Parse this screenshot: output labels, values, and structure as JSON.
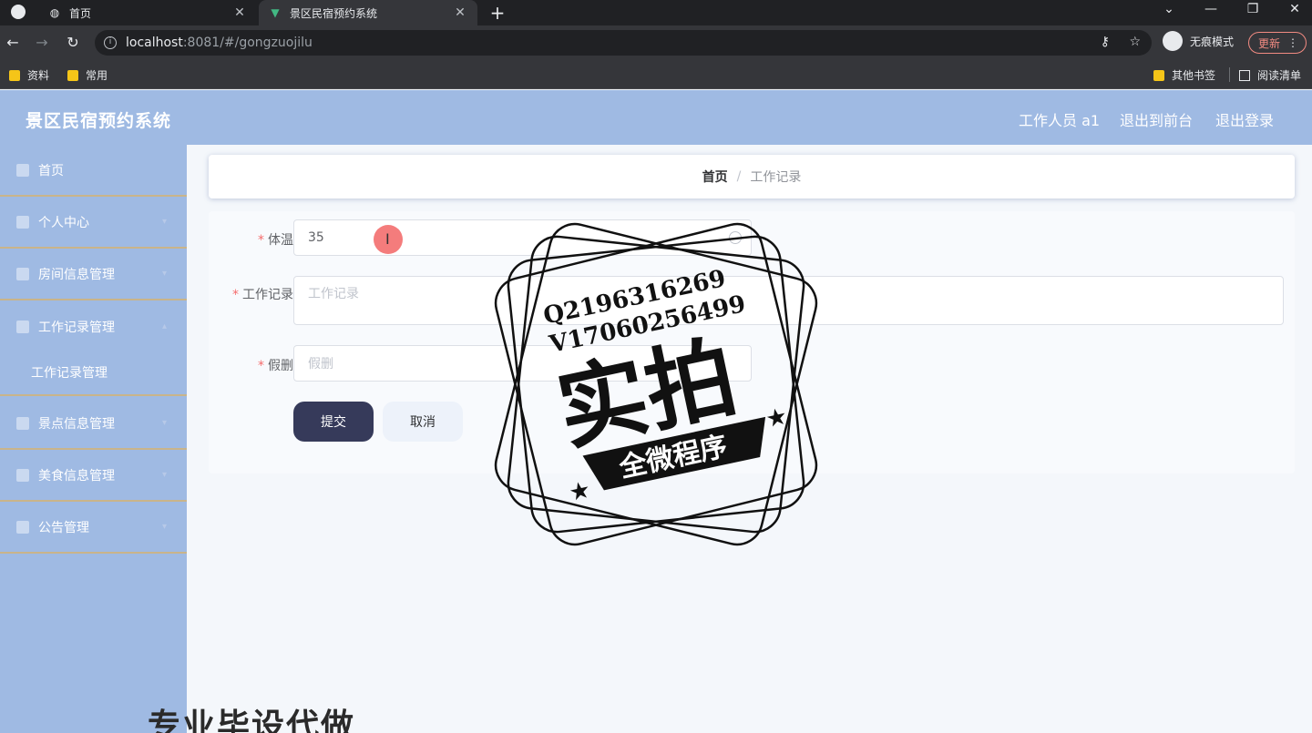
{
  "browser": {
    "tabs": [
      {
        "label": "首页",
        "icon": "globe-icon"
      },
      {
        "label": "景区民宿预约系统",
        "icon": "vue-logo-icon"
      }
    ],
    "url_host": "localhost",
    "url_rest": ":8081/#/gongzuojilu",
    "incognito_label": "无痕模式",
    "update_label": "更新",
    "bookmarks": [
      "资料",
      "常用"
    ],
    "bookmarks_right": [
      "其他书签",
      "阅读清单"
    ]
  },
  "header": {
    "title": "景区民宿预约系统",
    "user_label": "工作人员 a1",
    "to_front_label": "退出到前台",
    "logout_label": "退出登录",
    "bg_color": "#9fbae3"
  },
  "sidebar": {
    "items": [
      {
        "label": "首页",
        "icon": "home-icon"
      },
      {
        "label": "个人中心",
        "icon": "user-icon"
      },
      {
        "label": "房间信息管理",
        "icon": "room-icon"
      },
      {
        "label": "工作记录管理",
        "icon": "record-icon"
      },
      {
        "label": "景点信息管理",
        "icon": "grid-icon"
      },
      {
        "label": "美食信息管理",
        "icon": "user-icon"
      },
      {
        "label": "公告管理",
        "icon": "notice-icon"
      }
    ],
    "sub_items": [
      "工作记录管理"
    ]
  },
  "breadcrumb": {
    "home": "首页",
    "separator": "/",
    "current": "工作记录"
  },
  "form": {
    "temperature": {
      "label": "体温",
      "value": "35"
    },
    "work_record": {
      "label": "工作记录",
      "placeholder": "工作记录"
    },
    "leave": {
      "label": "假删",
      "placeholder": "假删"
    },
    "submit_label": "提交",
    "cancel_label": "取消",
    "required_mark": "*"
  },
  "watermark": {
    "line1": "Q2196316269",
    "line2": "V17060256499",
    "big": "实拍",
    "banner": "全微程序",
    "bottom": "专业毕设代做"
  }
}
